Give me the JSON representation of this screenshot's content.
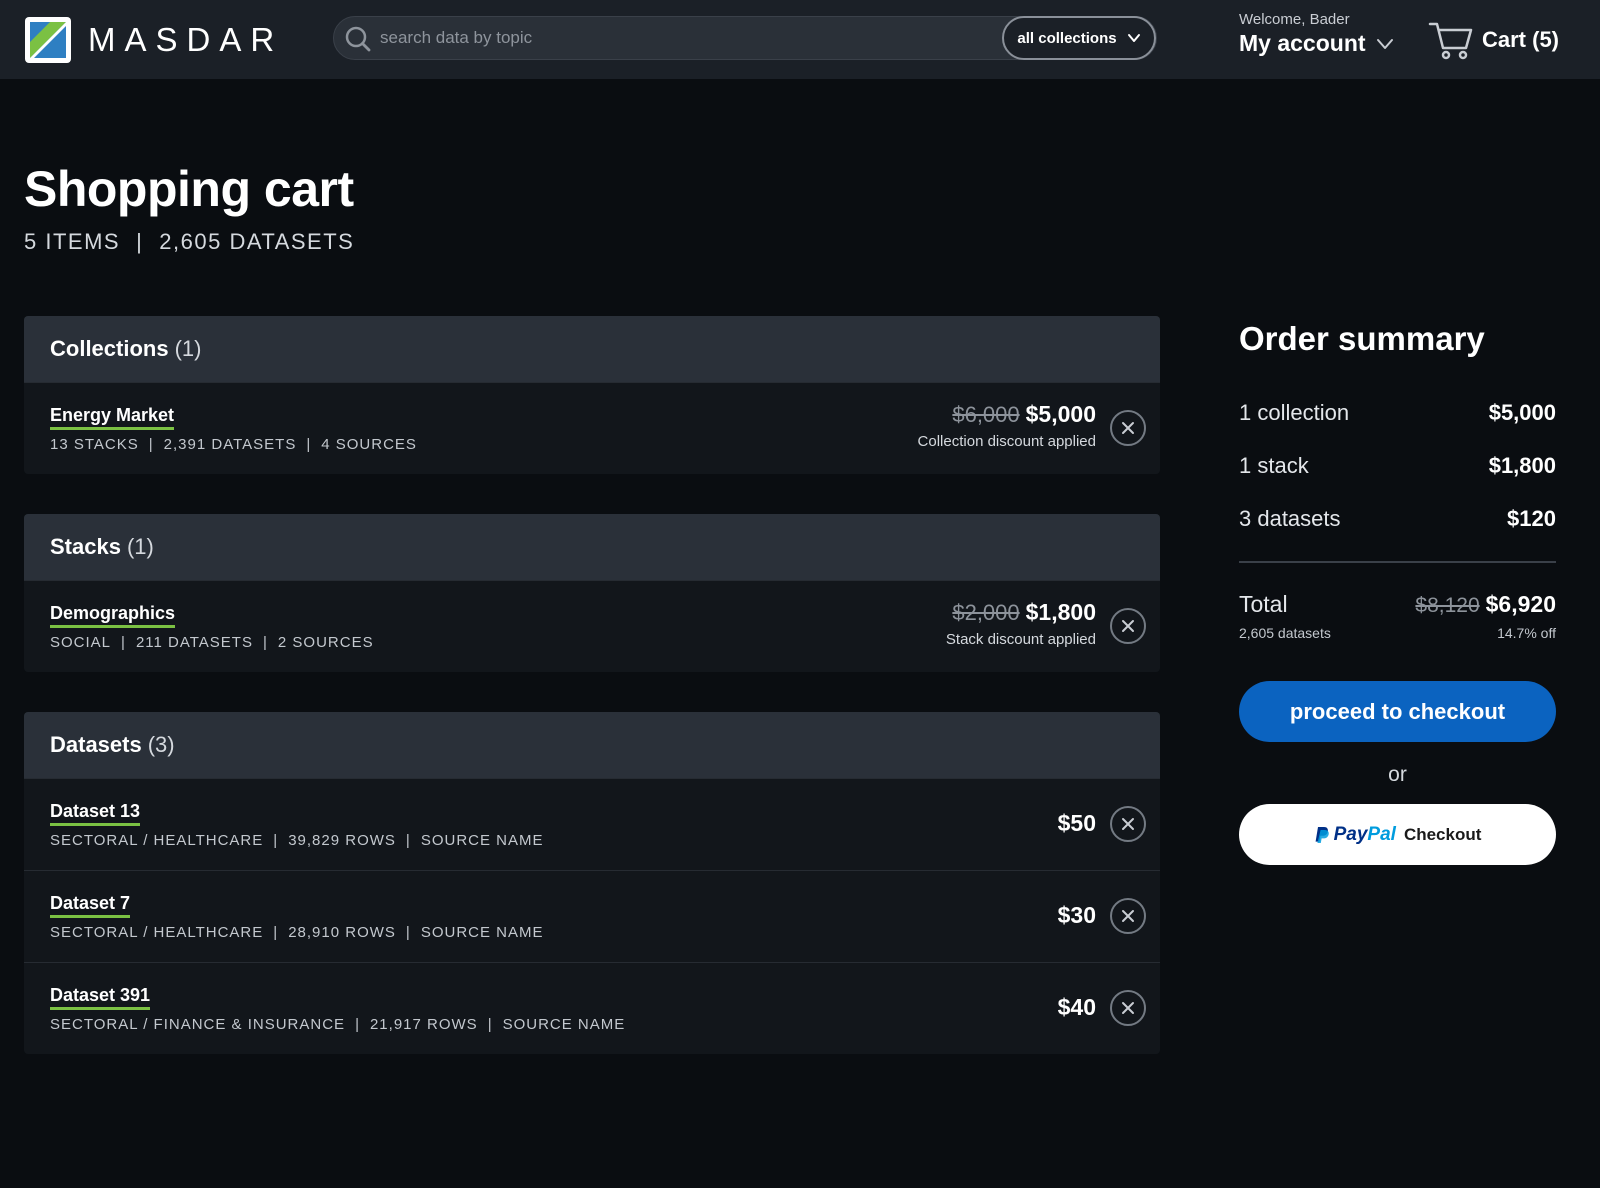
{
  "header": {
    "brand": "MASDAR",
    "search_placeholder": "search data by topic",
    "collections_filter": "all collections",
    "welcome": "Welcome, Bader",
    "account_label": "My account",
    "cart_label": "Cart (5)"
  },
  "page": {
    "title": "Shopping cart",
    "items_count": "5 ITEMS",
    "separator": "|",
    "datasets_count": "2,605 DATASETS"
  },
  "collections": {
    "title": "Collections",
    "count": "(1)",
    "items": [
      {
        "name": "Energy Market",
        "meta": [
          "13 STACKS",
          "2,391 DATASETS",
          "4 SOURCES"
        ],
        "old_price": "$6,000",
        "price": "$5,000",
        "note": "Collection discount applied"
      }
    ]
  },
  "stacks": {
    "title": "Stacks",
    "count": "(1)",
    "items": [
      {
        "name": "Demographics",
        "meta": [
          "SOCIAL",
          "211 DATASETS",
          "2 SOURCES"
        ],
        "old_price": "$2,000",
        "price": "$1,800",
        "note": "Stack discount applied"
      }
    ]
  },
  "datasets": {
    "title": "Datasets",
    "count": "(3)",
    "items": [
      {
        "name": "Dataset 13",
        "meta": [
          "SECTORAL / HEALTHCARE",
          "39,829  ROWS",
          "SOURCE NAME"
        ],
        "price": "$50"
      },
      {
        "name": "Dataset 7",
        "meta": [
          "SECTORAL / HEALTHCARE",
          "28,910  ROWS",
          "SOURCE NAME"
        ],
        "price": "$30"
      },
      {
        "name": "Dataset 391",
        "meta": [
          "SECTORAL / FINANCE & INSURANCE",
          "21,917  ROWS",
          "SOURCE NAME"
        ],
        "price": "$40"
      }
    ]
  },
  "summary": {
    "title": "Order summary",
    "rows": [
      {
        "label": "1 collection",
        "value": "$5,000"
      },
      {
        "label": "1 stack",
        "value": "$1,800"
      },
      {
        "label": "3 datasets",
        "value": "$120"
      }
    ],
    "total_label": "Total",
    "total_datasets": "2,605 datasets",
    "total_old": "$8,120",
    "total_new": "$6,920",
    "total_off": "14.7% off",
    "checkout_label": "proceed to checkout",
    "or_label": "or",
    "paypal_pay": "Pay",
    "paypal_pal": "Pal",
    "paypal_checkout": "Checkout"
  },
  "colors": {
    "background": "#0a0d11",
    "header": "#1b2027",
    "section_header": "#2a3039",
    "accent_green": "#7bc143",
    "checkout_blue": "#0b63c0"
  },
  "icons": {
    "logo": "masdar-logo-icon",
    "search": "search-icon",
    "dropdown": "chevron-down-icon",
    "cart": "cart-icon",
    "remove": "close-icon",
    "paypal": "paypal-icon"
  }
}
